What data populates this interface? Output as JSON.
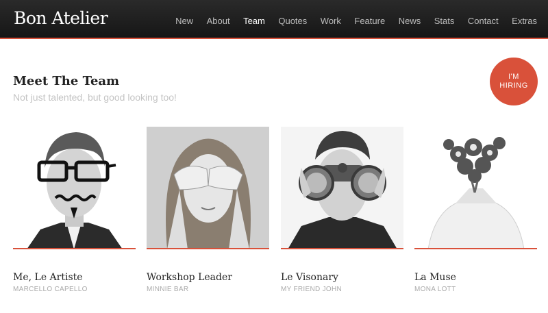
{
  "header": {
    "brand": "Bon Atelier",
    "nav": [
      {
        "label": "New"
      },
      {
        "label": "About"
      },
      {
        "label": "Team",
        "active": true
      },
      {
        "label": "Quotes"
      },
      {
        "label": "Work"
      },
      {
        "label": "Feature"
      },
      {
        "label": "News"
      },
      {
        "label": "Stats"
      },
      {
        "label": "Contact"
      },
      {
        "label": "Extras"
      }
    ]
  },
  "team": {
    "title": "Meet The Team",
    "subtitle": "Not just talented, but good looking too!",
    "hiring_badge": {
      "line1": "I'M",
      "line2": "HIRING"
    },
    "members": [
      {
        "role": "Me, Le Artiste",
        "name": "MARCELLO CAPELLO",
        "photo": "man-with-drawn-glasses-photo"
      },
      {
        "role": "Workshop Leader",
        "name": "MINNIE BAR",
        "photo": "woman-covering-eyes-photo"
      },
      {
        "role": "Le Visonary",
        "name": "MY FRIEND JOHN",
        "photo": "man-with-binoculars-photo"
      },
      {
        "role": "La Muse",
        "name": "MONA LOTT",
        "photo": "flower-bouquet-photo"
      }
    ]
  },
  "colors": {
    "accent": "#d9513a",
    "navbar": "#1c1c1c"
  }
}
